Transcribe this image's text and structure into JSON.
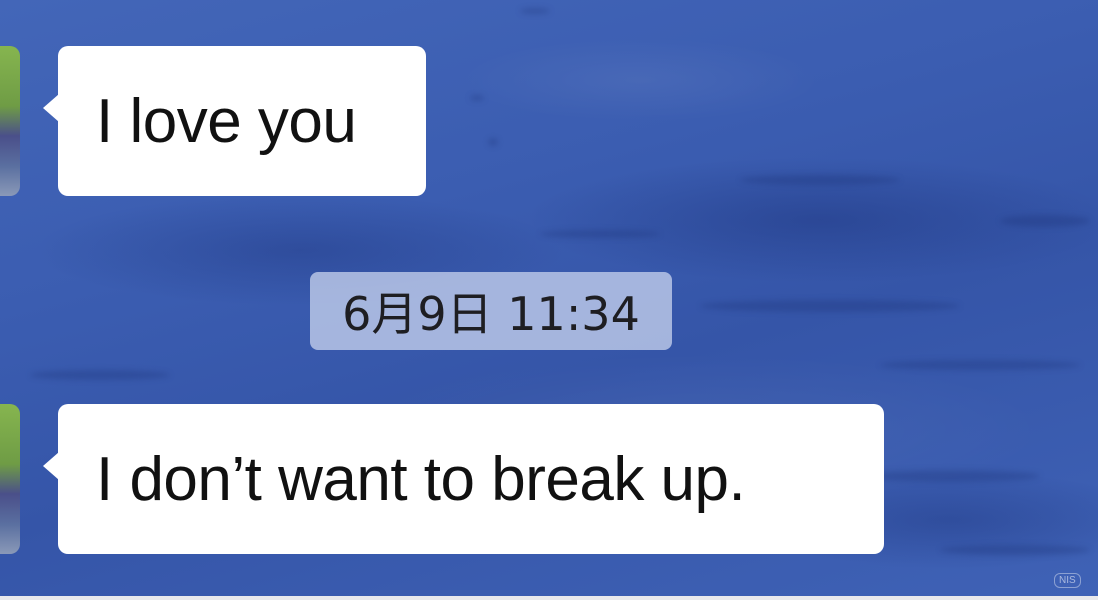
{
  "messages": [
    {
      "sender": "contact",
      "text": "I love you"
    },
    {
      "sender": "contact",
      "text": "I don’t want to break up."
    }
  ],
  "timestamp": "6月9日 11:34",
  "watermark": "NIS",
  "colors": {
    "background": "#3b5db1",
    "bubble": "#ffffff",
    "timestamp_pill": "#c4d0ec",
    "text": "#111111"
  }
}
